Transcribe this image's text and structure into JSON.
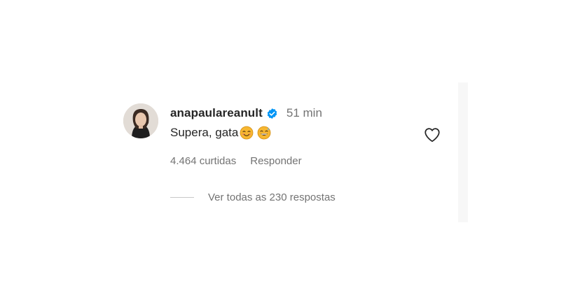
{
  "comment": {
    "username": "anapaulareanult",
    "verified": true,
    "time": "51 min",
    "text": "Supera, gata",
    "emojis": [
      "smiling-face-emoji",
      "grinning-sweat-emoji"
    ],
    "likes": "4.464 curtidas",
    "reply_label": "Responder",
    "view_replies": "Ver todas as 230 respostas"
  },
  "colors": {
    "text": "#262626",
    "secondary": "#737373",
    "verified": "#0095f6",
    "divider": "#c7c7c7"
  }
}
